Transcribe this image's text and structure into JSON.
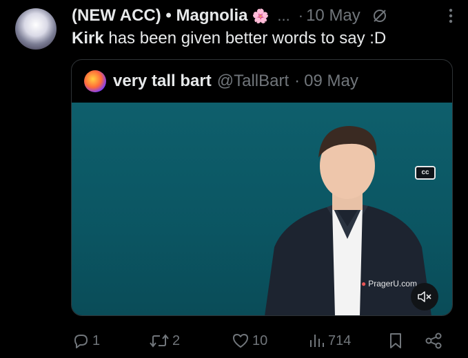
{
  "tweet": {
    "author_name": "(NEW ACC) • Magnolia",
    "name_emoji": "🌸",
    "overflow_dots": "...",
    "separator": "·",
    "date": "10 May",
    "text_bold": "Kirk",
    "text_rest": " has been given better words to say :D"
  },
  "quoted": {
    "name": "very tall bart",
    "handle": "@TallBart",
    "separator": "·",
    "date": "09 May",
    "video": {
      "cc_label": "cc",
      "watermark": "PragerU.com"
    }
  },
  "actions": {
    "reply_count": "1",
    "retweet_count": "2",
    "like_count": "10",
    "views_count": "714"
  },
  "icons": [
    "slash-icon",
    "more-icon",
    "cc-icon",
    "mute-icon",
    "reply-icon",
    "retweet-icon",
    "like-icon",
    "views-icon",
    "bookmark-icon",
    "share-icon"
  ],
  "colors": {
    "background": "#000000",
    "text": "#e7e9ea",
    "muted": "#71767b",
    "border": "#2f3336",
    "video_bg": "#0b5562"
  }
}
